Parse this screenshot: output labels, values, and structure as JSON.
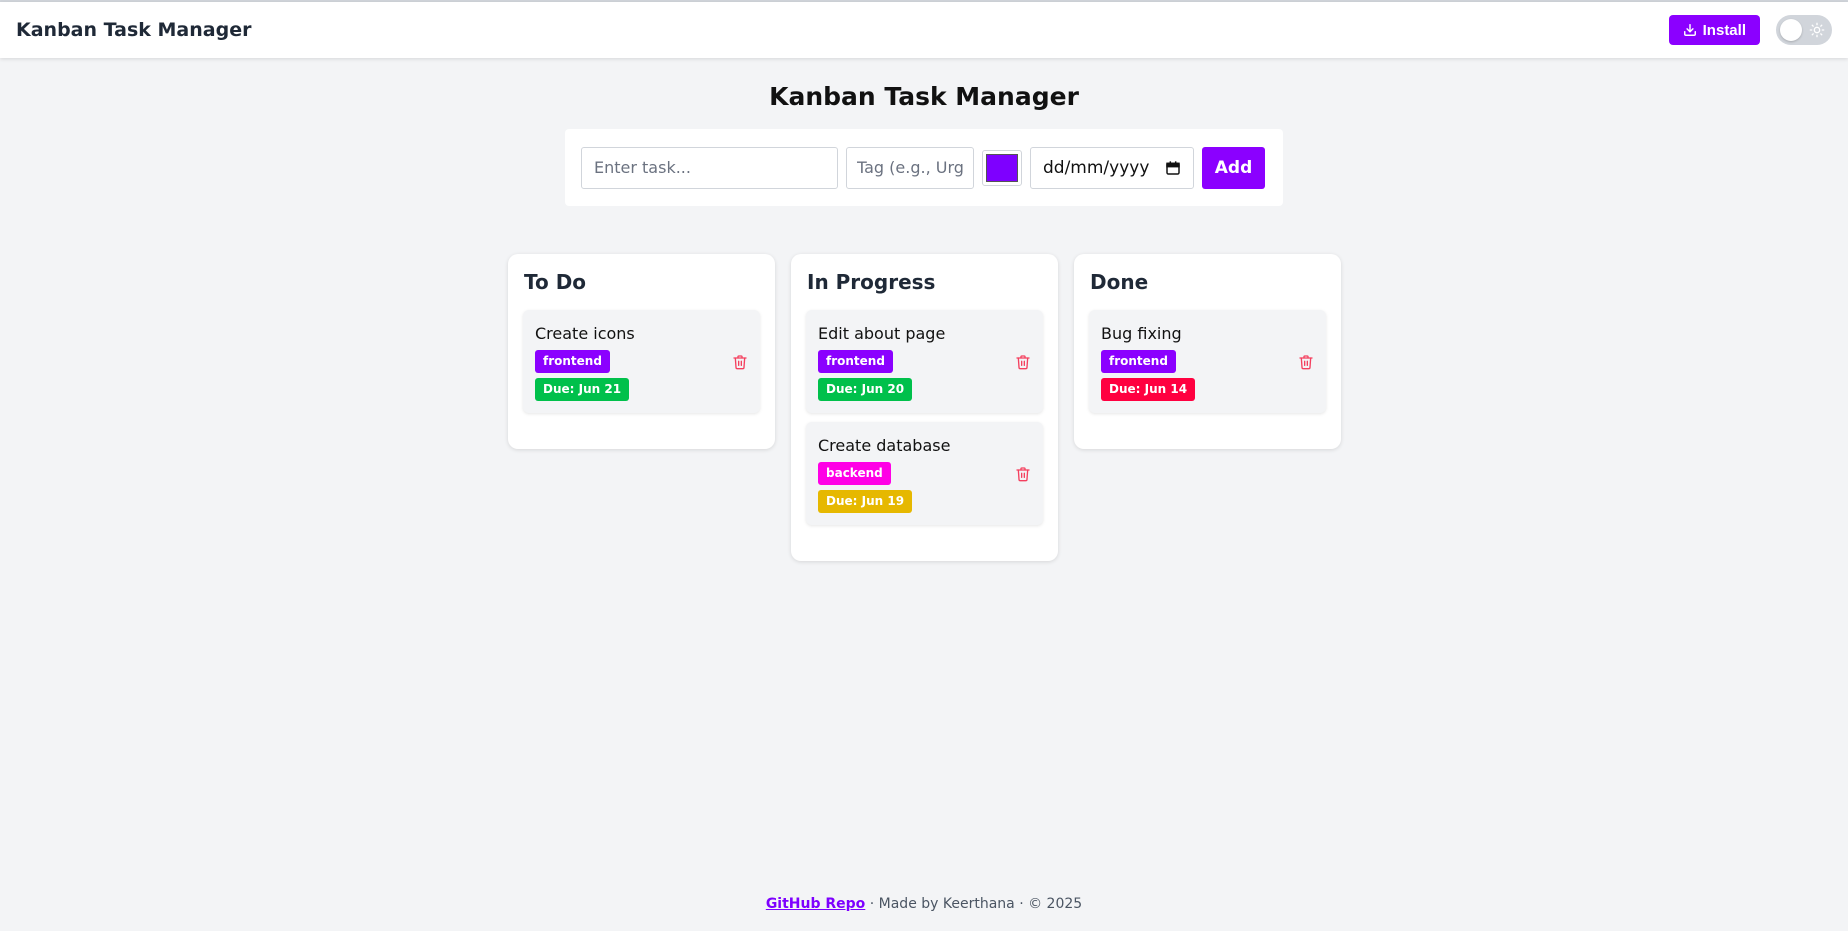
{
  "navbar": {
    "brand": "Kanban Task Manager",
    "install_label": "Install"
  },
  "page": {
    "title": "Kanban Task Manager"
  },
  "form": {
    "task_placeholder": "Enter task...",
    "tag_placeholder": "Tag (e.g., Urgent)",
    "selected_color": "#7e00ff",
    "date_placeholder": "dd/mm/yyyy",
    "add_label": "Add"
  },
  "columns": [
    {
      "title": "To Do",
      "cards": [
        {
          "title": "Create icons",
          "tag": "frontend",
          "tag_color": "#8b00ff",
          "due": "Due: Jun 21",
          "due_color": "#00c04b"
        }
      ]
    },
    {
      "title": "In Progress",
      "cards": [
        {
          "title": "Edit about page",
          "tag": "frontend",
          "tag_color": "#8b00ff",
          "due": "Due: Jun 20",
          "due_color": "#00c04b"
        },
        {
          "title": "Create database",
          "tag": "backend",
          "tag_color": "#ff00e6",
          "due": "Due: Jun 19",
          "due_color": "#e6b800"
        }
      ]
    },
    {
      "title": "Done",
      "cards": [
        {
          "title": "Bug fixing",
          "tag": "frontend",
          "tag_color": "#8b00ff",
          "due": "Due: Jun 14",
          "due_color": "#ff0040"
        }
      ]
    }
  ],
  "footer": {
    "link_label": "GitHub Repo",
    "text": " · Made by Keerthana · © 2025"
  },
  "colors": {
    "accent": "#8b00ff",
    "background": "#f3f4f6"
  }
}
